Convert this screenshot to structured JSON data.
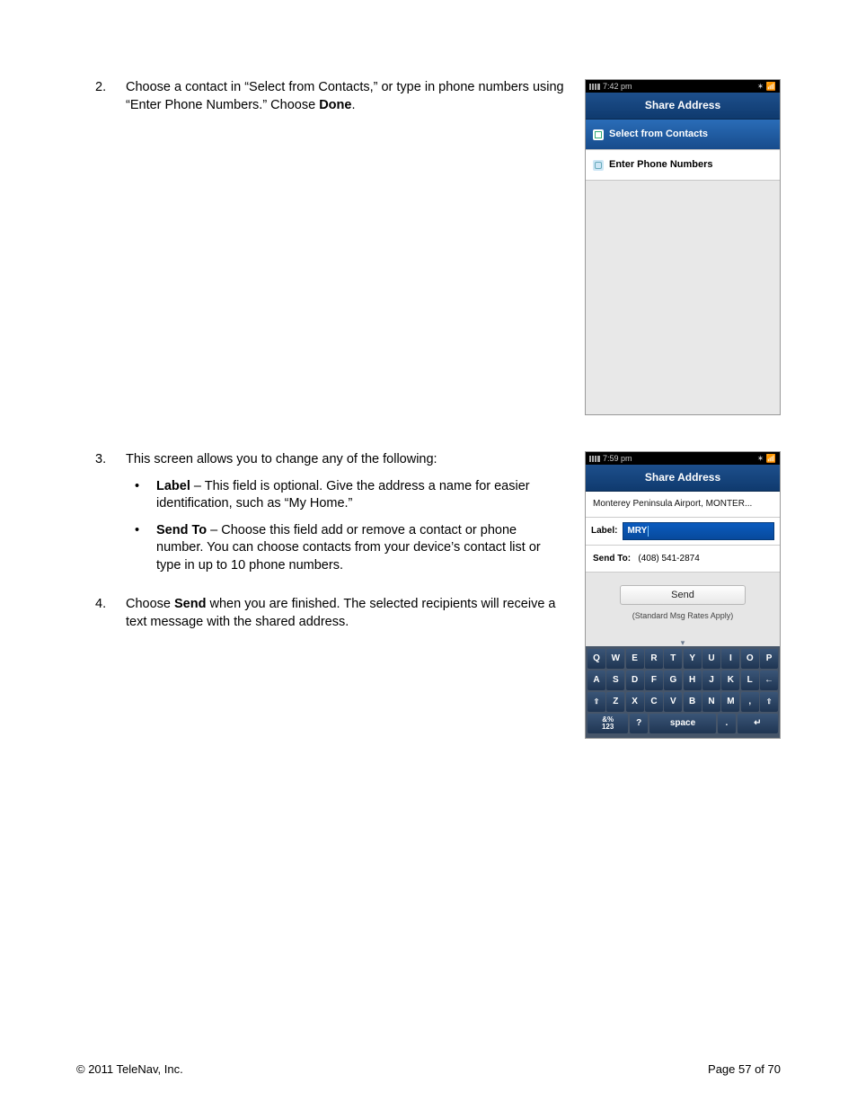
{
  "steps": {
    "s2": {
      "num": "2.",
      "text_a": "Choose a contact in “Select from Contacts,” or type in phone numbers using “Enter Phone Numbers.” Choose ",
      "bold_a": "Done",
      "text_b": "."
    },
    "s3": {
      "num": "3.",
      "intro": "This screen allows you to change any of the following:"
    },
    "s3_b1": {
      "label": "Label",
      "rest": " – This field is optional. Give the address a name for easier identification, such as “My Home.”"
    },
    "s3_b2": {
      "label": "Send To",
      "rest": " – Choose this field add or remove a contact or phone number. You can choose contacts from your device’s contact list or type in up to 10 phone numbers."
    },
    "s4": {
      "num": "4.",
      "text_a": "Choose ",
      "bold_a": "Send",
      "text_b": " when you are finished. The selected recipients will receive a text message with the shared address."
    }
  },
  "phone1": {
    "time": "7:42 pm",
    "title": "Share Address",
    "item1": "Select from Contacts",
    "item2": "Enter Phone Numbers"
  },
  "phone2": {
    "time": "7:59 pm",
    "title": "Share Address",
    "address": "Monterey Peninsula Airport, MONTER...",
    "label_caption": "Label:",
    "label_value": "MRY",
    "sendto_caption": "Send To:",
    "sendto_value": "(408) 541-2874",
    "send_btn": "Send",
    "rates": "(Standard Msg Rates Apply)",
    "keys_r1": [
      "Q",
      "W",
      "E",
      "R",
      "T",
      "Y",
      "U",
      "I",
      "O",
      "P"
    ],
    "keys_r2": [
      "A",
      "S",
      "D",
      "F",
      "G",
      "H",
      "J",
      "K",
      "L",
      "←"
    ],
    "keys_r3": [
      "⇧",
      "Z",
      "X",
      "C",
      "V",
      "B",
      "N",
      "M",
      ",",
      "⇧"
    ],
    "keys_r4": {
      "sym1": "&%",
      "sym2": "123",
      "q": "?",
      "space": "space",
      "dot": ".",
      "enter": "↵"
    }
  },
  "footer": {
    "left": "© 2011 TeleNav, Inc.",
    "right": "Page 57 of 70"
  }
}
